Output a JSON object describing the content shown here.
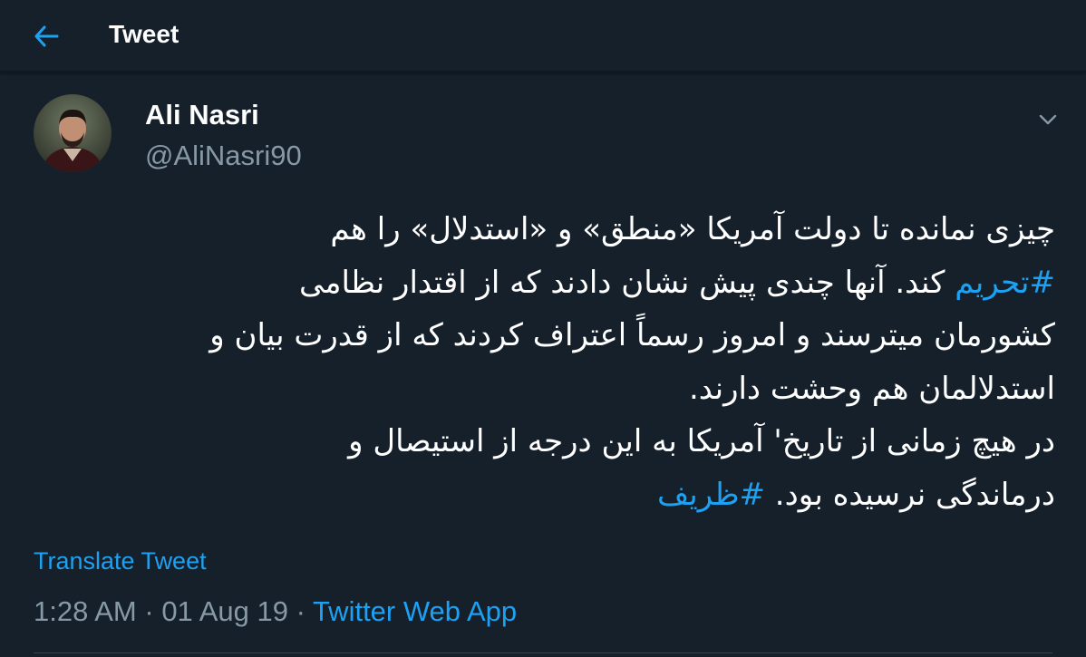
{
  "header": {
    "title": "Tweet",
    "back_icon": "arrow-left-icon",
    "accent": "#1da1f2"
  },
  "author": {
    "name": "Ali Nasri",
    "handle": "@AliNasri90",
    "avatar_icon": "profile-photo"
  },
  "tweet": {
    "lines": [
      {
        "text": "چیزی نمانده تا دولت آمریکا «منطق» و «استدلال» را هم",
        "hashtag": ""
      },
      {
        "hashtag": "#تحریم",
        "text": " کند.  آنها چندی پیش نشان دادند که از اقتدار نظامی"
      },
      {
        "text": "کشورمان میترسند و امروز رسماً اعتراف کردند که از قدرت بیان و",
        "hashtag": ""
      },
      {
        "text": "استدلالمان هم وحشت دارند.",
        "hashtag": ""
      },
      {
        "text": " در هیچ زمانی از تاریخ' آمریکا به این درجه از استیصال و",
        "hashtag": ""
      },
      {
        "text": "درماندگی نرسیده بود. ",
        "hashtag": "#ظریف"
      }
    ],
    "translate_label": "Translate Tweet",
    "time": "1:28 AM",
    "date": "01 Aug 19",
    "separator": " · ",
    "source": "Twitter Web App"
  },
  "colors": {
    "background": "#15202b",
    "secondary_text": "#8899a6",
    "link": "#1da1f2"
  },
  "more_icon": "chevron-down-icon"
}
